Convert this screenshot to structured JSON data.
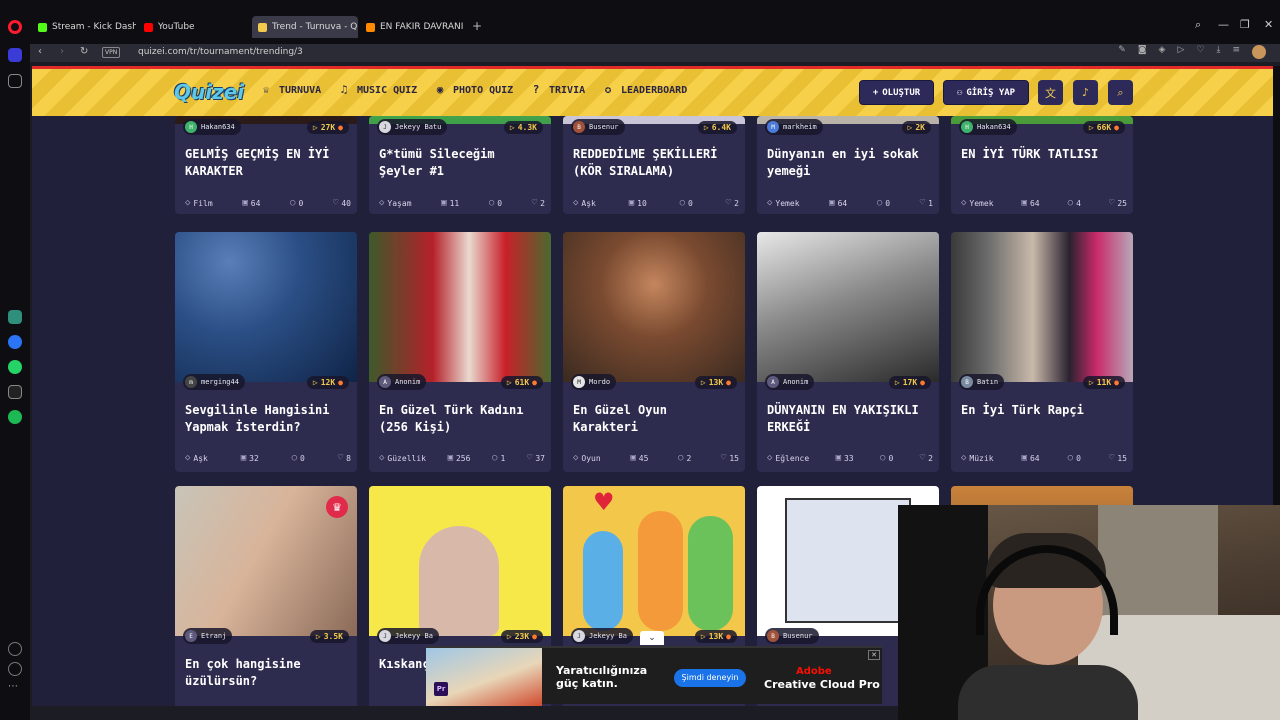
{
  "browser": {
    "tabs": [
      {
        "label": "Stream - Kick Dashboard",
        "color": "#53fc18"
      },
      {
        "label": "YouTube",
        "color": "#ff0000"
      },
      {
        "label": "Trend - Turnuva - Quizei",
        "color": "#f2c94c"
      },
      {
        "label": "EN FAKIR DAVRANIŞ - Tie",
        "color": "#ff8a00"
      }
    ],
    "vpn": "VPN",
    "url": "quizei.com/tr/tournament/trending/3"
  },
  "site": {
    "logo": "Quizei",
    "nav": [
      {
        "label": "TURNUVA",
        "icon": "trophy-icon",
        "glyph": "🏆"
      },
      {
        "label": "MUSIC QUIZ",
        "icon": "music-icon",
        "glyph": "♫"
      },
      {
        "label": "PHOTO QUIZ",
        "icon": "camera-icon",
        "glyph": "◉"
      },
      {
        "label": "TRIVIA",
        "icon": "question-icon",
        "glyph": "?"
      },
      {
        "label": "LEADERBOARD",
        "icon": "medal-icon",
        "glyph": "✪"
      }
    ],
    "create_label": "OLUŞTUR",
    "login_label": "GİRİŞ YAP"
  },
  "cards": [
    {
      "author": "Hakan634",
      "plays": "27K",
      "title": "GELMİŞ GEÇMİŞ EN İYİ KARAKTER",
      "category": "Film",
      "items": "64",
      "comments": "0",
      "likes": "40"
    },
    {
      "author": "Jekeyy Batu",
      "plays": "4.3K",
      "title": "G*tümü Sileceğim Şeyler #1",
      "category": "Yaşam",
      "items": "11",
      "comments": "0",
      "likes": "2"
    },
    {
      "author": "Busenur",
      "plays": "6.4K",
      "title": "REDDEDİLME ŞEKİLLERİ (KÖR SIRALAMA)",
      "category": "Aşk",
      "items": "10",
      "comments": "0",
      "likes": "2"
    },
    {
      "author": "markheim",
      "plays": "2K",
      "title": "Dünyanın en iyi sokak yemeği",
      "category": "Yemek",
      "items": "64",
      "comments": "0",
      "likes": "1"
    },
    {
      "author": "Hakan634",
      "plays": "66K",
      "title": "EN İYİ TÜRK TATLISI",
      "category": "Yemek",
      "items": "64",
      "comments": "4",
      "likes": "25"
    },
    {
      "author": "merging44",
      "plays": "12K",
      "title": "Sevgilinle Hangisini Yapmak İsterdin?",
      "category": "Aşk",
      "items": "32",
      "comments": "0",
      "likes": "8"
    },
    {
      "author": "Anonim",
      "plays": "61K",
      "title": "En Güzel Türk Kadını (256 Kişi)",
      "category": "Güzellik",
      "items": "256",
      "comments": "1",
      "likes": "37"
    },
    {
      "author": "Mordo",
      "plays": "13K",
      "title": "En Güzel Oyun Karakteri",
      "category": "Oyun",
      "items": "45",
      "comments": "2",
      "likes": "15"
    },
    {
      "author": "Anonim",
      "plays": "17K",
      "title": "DÜNYANIN EN YAKIŞIKLI ERKEĞİ",
      "category": "Eğlence",
      "items": "33",
      "comments": "0",
      "likes": "2"
    },
    {
      "author": "Batın",
      "plays": "11K",
      "title": "En İyi Türk Rapçi",
      "category": "Müzik",
      "items": "64",
      "comments": "0",
      "likes": "15"
    },
    {
      "author": "Etranj",
      "plays": "3.5K",
      "title": "En çok hangisine üzülürsün?",
      "category": "",
      "items": "",
      "comments": "",
      "likes": ""
    },
    {
      "author": "Jekeyy Ba",
      "plays": "23K",
      "title": "Kıskanç",
      "category": "",
      "items": "",
      "comments": "",
      "likes": ""
    },
    {
      "author": "Jekeyy Ba",
      "plays": "13K",
      "title": "",
      "category": "",
      "items": "",
      "comments": "",
      "likes": ""
    },
    {
      "author": "Busenur",
      "plays": "",
      "title": "",
      "category": "",
      "items": "",
      "comments": "",
      "likes": ""
    }
  ],
  "ad": {
    "headline_1": "Yaratıcılığınıza",
    "headline_2": "güç katın.",
    "cta": "Şimdi deneyin",
    "brand": "Adobe",
    "product": "Creative Cloud Pro",
    "app_badge": "Pr"
  }
}
